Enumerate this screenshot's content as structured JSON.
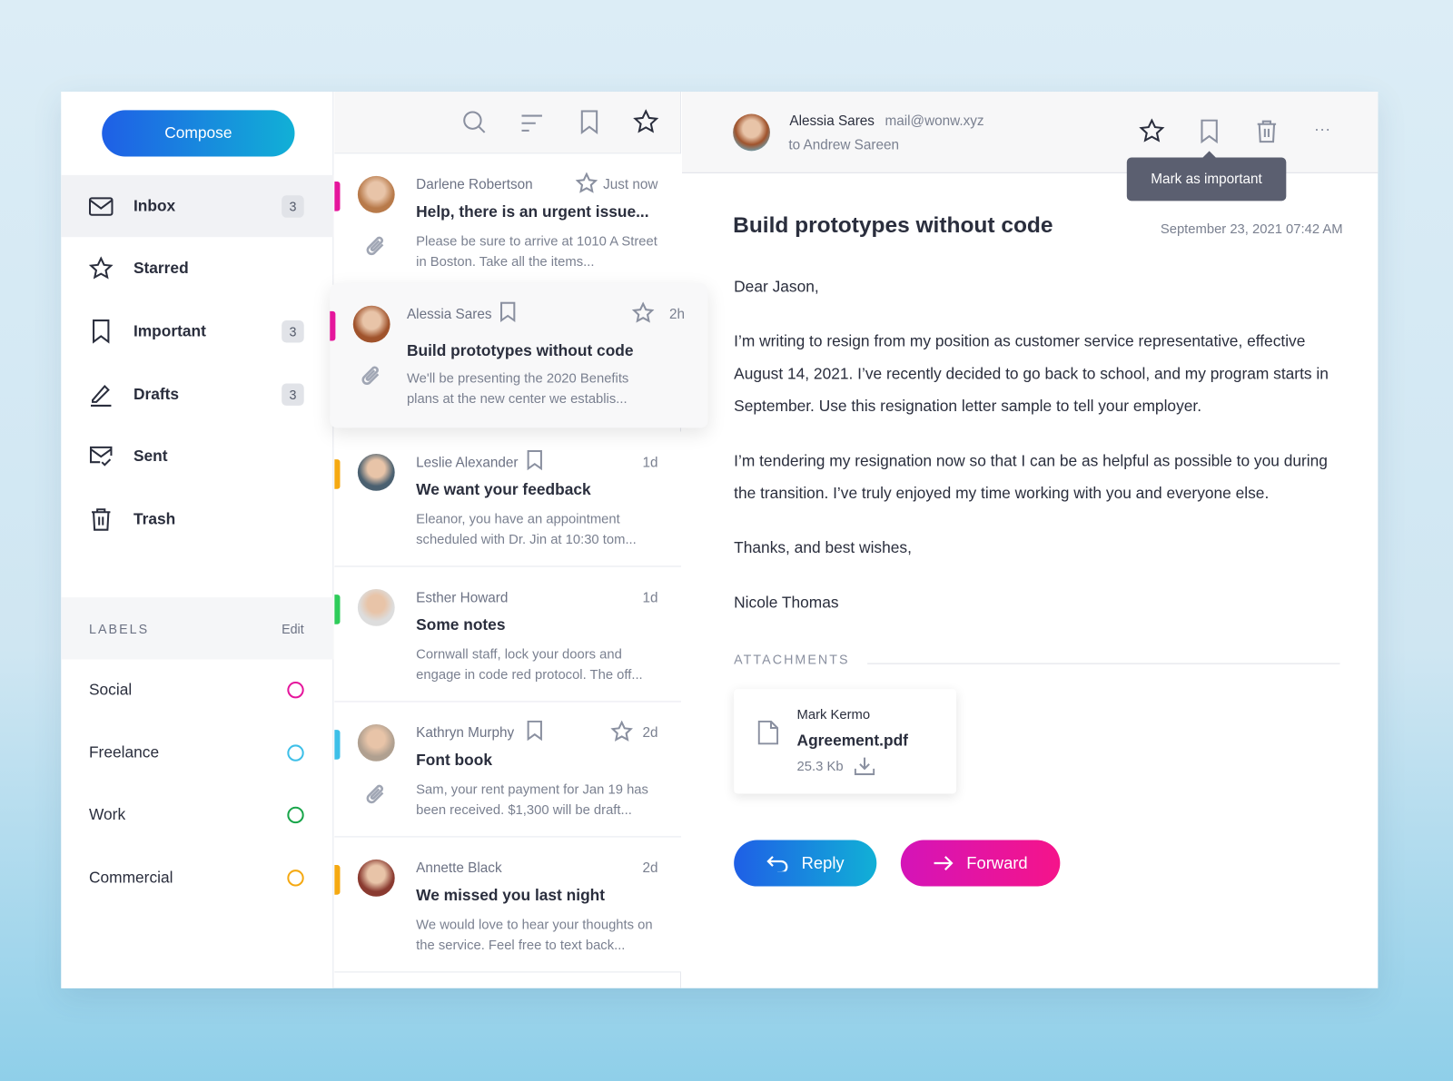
{
  "sidebar": {
    "compose": "Compose",
    "items": [
      {
        "label": "Inbox",
        "icon": "inbox-icon",
        "count": "3"
      },
      {
        "label": "Starred",
        "icon": "star-icon"
      },
      {
        "label": "Important",
        "icon": "bookmark-icon",
        "count": "3"
      },
      {
        "label": "Drafts",
        "icon": "pen-icon",
        "count": "3"
      },
      {
        "label": "Sent",
        "icon": "sent-icon"
      },
      {
        "label": "Trash",
        "icon": "trash-icon"
      }
    ],
    "labels_title": "LABELS",
    "labels_edit": "Edit",
    "labels": [
      {
        "name": "Social",
        "color": "#e5169c"
      },
      {
        "name": "Freelance",
        "color": "#3dbfe8"
      },
      {
        "name": "Work",
        "color": "#19a54a"
      },
      {
        "name": "Commercial",
        "color": "#f5a912"
      }
    ]
  },
  "messages": [
    {
      "from": "Darlene Robertson",
      "time": "Just now",
      "subject": "Help, there is an urgent issue...",
      "preview": "Please be sure to arrive at 1010 A Street in Boston. Take all the items...",
      "color": "#e5169c",
      "starred": true,
      "bookmark": false,
      "attachment": true
    },
    {
      "from": "Alessia Sares",
      "time": "2h",
      "subject": "Build prototypes without code",
      "preview": "We'll be presenting the 2020 Benefits plans at the new center we establis...",
      "color": "#e5169c",
      "starred": true,
      "bookmark": true,
      "attachment": true
    },
    {
      "from": "Leslie Alexander",
      "time": "1d",
      "subject": "We want your feedback",
      "preview": "Eleanor, you have an appointment scheduled with Dr. Jin at 10:30 tom...",
      "color": "#f5a912",
      "starred": false,
      "bookmark": true,
      "attachment": false
    },
    {
      "from": "Esther Howard",
      "time": "1d",
      "subject": "Some notes",
      "preview": "Cornwall staff, lock your doors and engage in code red protocol. The off...",
      "color": "#2ecc5a",
      "starred": false,
      "bookmark": false,
      "attachment": false
    },
    {
      "from": "Kathryn Murphy",
      "time": "2d",
      "subject": "Font book",
      "preview": "Sam, your rent payment for Jan 19 has been received. $1,300 will be draft...",
      "color": "#3dbfe8",
      "starred": true,
      "bookmark": true,
      "attachment": true
    },
    {
      "from": "Annette Black",
      "time": "2d",
      "subject": "We missed you last night",
      "preview": "We would love to hear your thoughts on the service. Feel free to text back...",
      "color": "#f5a912",
      "starred": false,
      "bookmark": false,
      "attachment": false
    }
  ],
  "reader": {
    "sender": "Alessia Sares",
    "email": "mail@wonw.xyz",
    "to": "to Andrew Sareen",
    "tooltip": "Mark as important",
    "subject": "Build prototypes without code",
    "date": "September 23, 2021 07:42 AM",
    "paragraphs": [
      "Dear Jason,",
      "I’m writing to resign from my position as customer service representative, effective August 14, 2021.  I’ve recently decided to go back to school, and my program starts in September.  Use this resignation letter sample to tell your employer.",
      "I’m tendering my resignation now so that I can be as helpful as possible to you during the transition.  I’ve truly enjoyed my time working with you and everyone else.",
      "Thanks, and best wishes,",
      "Nicole Thomas"
    ],
    "attachments_title": "ATTACHMENTS",
    "attachment": {
      "owner": "Mark Kermo",
      "name": "Agreement.pdf",
      "size": "25.3 Kb"
    },
    "reply": "Reply",
    "forward": "Forward"
  }
}
